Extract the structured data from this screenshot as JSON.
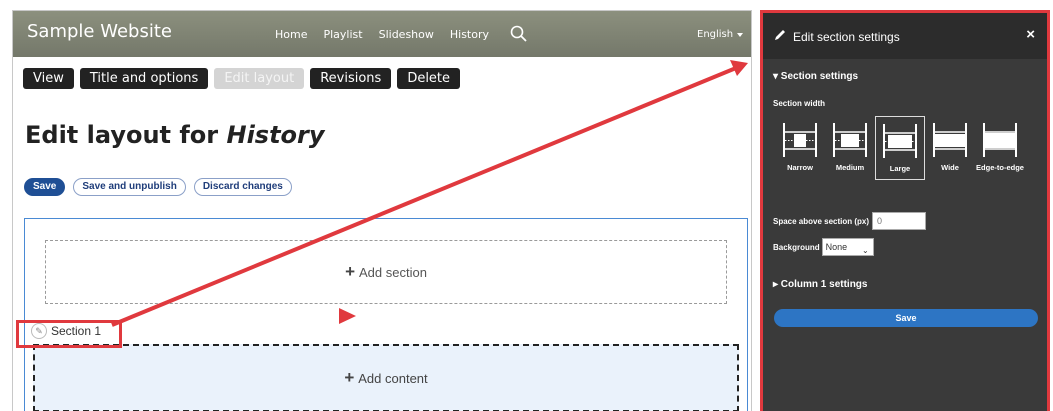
{
  "site": {
    "name": "Sample Website",
    "nav": [
      "Home",
      "Playlist",
      "Slideshow",
      "History"
    ],
    "language": "English"
  },
  "tabs": [
    {
      "label": "View",
      "active": false
    },
    {
      "label": "Title and options",
      "active": false
    },
    {
      "label": "Edit layout",
      "active": true
    },
    {
      "label": "Revisions",
      "active": false
    },
    {
      "label": "Delete",
      "active": false
    }
  ],
  "page": {
    "title_prefix": "Edit layout for ",
    "title_node": "History"
  },
  "actions": {
    "save": "Save",
    "save_unpublish": "Save and unpublish",
    "discard": "Discard changes"
  },
  "layout": {
    "add_section": "Add section",
    "section_label": "Section 1",
    "add_content": "Add content"
  },
  "panel": {
    "title": "Edit section settings",
    "close": "×",
    "section_settings": "▾ Section settings",
    "section_width_label": "Section width",
    "width_options": [
      "Narrow",
      "Medium",
      "Large",
      "Wide",
      "Edge-to-edge"
    ],
    "selected_width": "Large",
    "space_above_label": "Space above section (px)",
    "space_above_value": "0",
    "background_label": "Background",
    "background_value": "None",
    "column_settings": "▸ Column 1 settings",
    "save": "Save"
  },
  "colors": {
    "accent_red": "#e0393e",
    "primary_blue": "#1f4f95",
    "panel_save_blue": "#2d75c4",
    "topbar": "#7f8373"
  }
}
